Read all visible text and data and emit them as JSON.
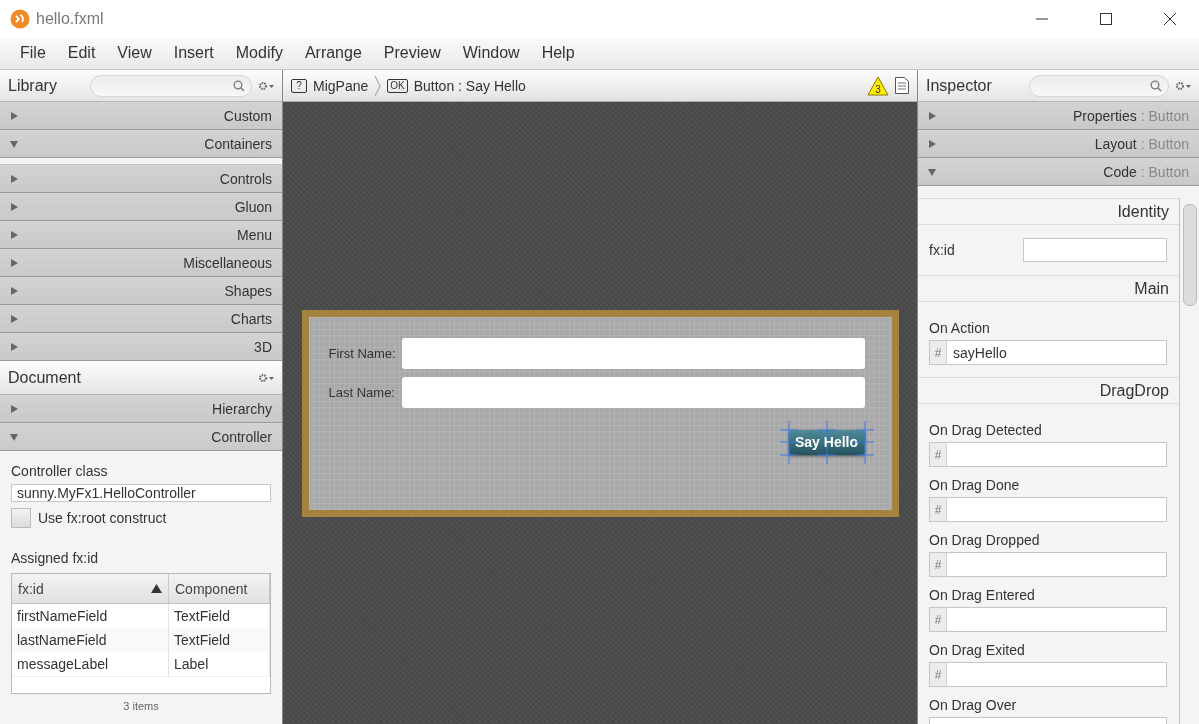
{
  "window": {
    "title": "hello.fxml"
  },
  "menu": [
    "File",
    "Edit",
    "View",
    "Insert",
    "Modify",
    "Arrange",
    "Preview",
    "Window",
    "Help"
  ],
  "library": {
    "title": "Library",
    "sections": [
      {
        "label": "Custom",
        "expanded": false
      },
      {
        "label": "Containers",
        "expanded": true
      },
      {
        "label": "Controls",
        "expanded": false
      },
      {
        "label": "Gluon",
        "expanded": false
      },
      {
        "label": "Menu",
        "expanded": false
      },
      {
        "label": "Miscellaneous",
        "expanded": false
      },
      {
        "label": "Shapes",
        "expanded": false
      },
      {
        "label": "Charts",
        "expanded": false
      },
      {
        "label": "3D",
        "expanded": false
      }
    ]
  },
  "document": {
    "title": "Document",
    "sections": [
      {
        "label": "Hierarchy",
        "expanded": false
      },
      {
        "label": "Controller",
        "expanded": true
      }
    ],
    "controller_class": {
      "label": "Controller class",
      "value": "sunny.MyFx1.HelloController"
    },
    "fx_root": {
      "label": "Use fx:root construct",
      "checked": false
    },
    "assigned": {
      "title": "Assigned fx:id",
      "columns": [
        {
          "label": "fx:id",
          "sorted": true
        },
        {
          "label": "Component",
          "sorted": false
        }
      ],
      "rows": [
        [
          "firstNameField",
          "TextField"
        ],
        [
          "lastNameField",
          "TextField"
        ],
        [
          "messageLabel",
          "Label"
        ]
      ],
      "footer": "3 items"
    }
  },
  "breadcrumb": [
    {
      "badge": "?",
      "label": "MigPane"
    },
    {
      "badge": "OK",
      "label": "Button : Say Hello"
    }
  ],
  "warnings": "3",
  "form": {
    "fields": [
      {
        "label": "First Name:"
      },
      {
        "label": "Last Name:"
      }
    ],
    "button": {
      "label": "Say Hello",
      "selected": true
    }
  },
  "inspector": {
    "title": "Inspector",
    "sections": [
      {
        "label": "Properties",
        "detail": ": Button",
        "expanded": false
      },
      {
        "label": "Layout",
        "detail": ": Button",
        "expanded": false
      },
      {
        "label": "Code",
        "detail": ": Button",
        "expanded": true
      }
    ],
    "groups": [
      {
        "heading": "Identity",
        "fields": [
          {
            "kind": "inline",
            "label": "fx:id"
          }
        ]
      },
      {
        "heading": "Main",
        "fields": [
          {
            "kind": "handler",
            "label": "On Action",
            "prefix": "#",
            "value": "sayHello"
          }
        ]
      },
      {
        "heading": "DragDrop",
        "fields": [
          {
            "kind": "handler",
            "label": "On Drag Detected",
            "prefix": "#"
          },
          {
            "kind": "handler",
            "label": "On Drag Done",
            "prefix": "#"
          },
          {
            "kind": "handler",
            "label": "On Drag Dropped",
            "prefix": "#"
          },
          {
            "kind": "handler",
            "label": "On Drag Entered",
            "prefix": "#"
          },
          {
            "kind": "handler",
            "label": "On Drag Exited",
            "prefix": "#"
          },
          {
            "kind": "handler",
            "label": "On Drag Over"
          }
        ]
      }
    ]
  }
}
